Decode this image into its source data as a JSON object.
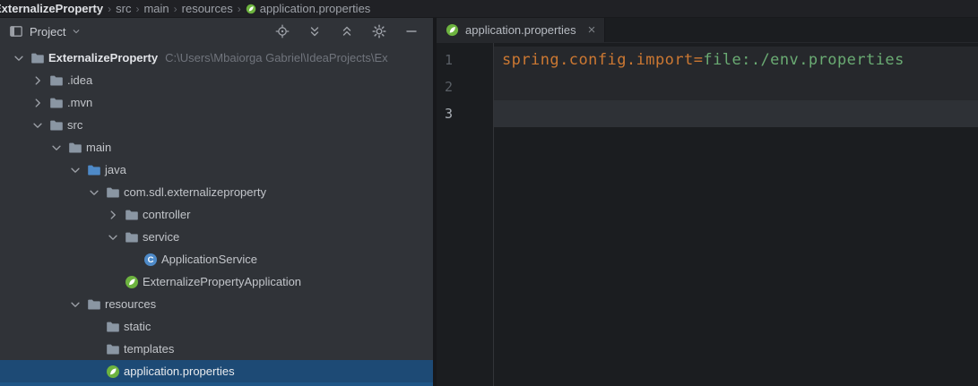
{
  "colors": {
    "selection_blue": "#1D4A75",
    "spring_green": "#6DB33F",
    "property_key": "#CC7832",
    "property_value": "#6AAB73"
  },
  "navbar": {
    "separator": "›",
    "items": [
      {
        "label": "ExternalizeProperty",
        "bold": true
      },
      {
        "label": "src"
      },
      {
        "label": "main"
      },
      {
        "label": "resources"
      },
      {
        "label": "application.properties",
        "icon": "spring-properties-icon"
      }
    ]
  },
  "project_panel": {
    "title": "Project",
    "toolbar_icons": [
      "locate-icon",
      "expand-all-icon",
      "collapse-all-icon",
      "settings-gear-icon",
      "minimize-icon"
    ],
    "tree": [
      {
        "label": "ExternalizeProperty",
        "path": "C:\\Users\\Mbaiorga Gabriel\\IdeaProjects\\Ex",
        "level": 0,
        "chevron": "down",
        "icon": "project-folder-icon",
        "bold": true
      },
      {
        "label": ".idea",
        "level": 1,
        "chevron": "right",
        "icon": "folder-icon"
      },
      {
        "label": ".mvn",
        "level": 1,
        "chevron": "right",
        "icon": "folder-icon"
      },
      {
        "label": "src",
        "level": 1,
        "chevron": "down",
        "icon": "folder-icon"
      },
      {
        "label": "main",
        "level": 2,
        "chevron": "down",
        "icon": "folder-icon"
      },
      {
        "label": "java",
        "level": 3,
        "chevron": "down",
        "icon": "source-folder-icon"
      },
      {
        "label": "com.sdl.externalizeproperty",
        "level": 4,
        "chevron": "down",
        "icon": "package-icon"
      },
      {
        "label": "controller",
        "level": 5,
        "chevron": "right",
        "icon": "package-icon"
      },
      {
        "label": "service",
        "level": 5,
        "chevron": "down",
        "icon": "package-icon"
      },
      {
        "label": "ApplicationService",
        "level": 6,
        "chevron": "none",
        "icon": "class-icon"
      },
      {
        "label": "ExternalizePropertyApplication",
        "level": 5,
        "chevron": "none",
        "icon": "spring-boot-icon"
      },
      {
        "label": "resources",
        "level": 3,
        "chevron": "down",
        "icon": "folder-icon"
      },
      {
        "label": "static",
        "level": 4,
        "chevron": "none",
        "icon": "folder-icon"
      },
      {
        "label": "templates",
        "level": 4,
        "chevron": "none",
        "icon": "folder-icon"
      },
      {
        "label": "application.properties",
        "level": 4,
        "chevron": "none",
        "icon": "spring-properties-icon",
        "selected": true
      }
    ]
  },
  "editor": {
    "tab": {
      "label": "application.properties",
      "icon": "spring-properties-icon",
      "close_glyph": "×"
    },
    "lines": [
      {
        "number": "1",
        "segments": [
          {
            "text": "spring.config.import",
            "color": "property_key"
          },
          {
            "text": "=",
            "color": "property_key"
          },
          {
            "text": "file:./env.properties",
            "color": "property_value"
          }
        ]
      },
      {
        "number": "2",
        "segments": []
      },
      {
        "number": "3",
        "segments": [],
        "caret_line": true
      }
    ]
  }
}
